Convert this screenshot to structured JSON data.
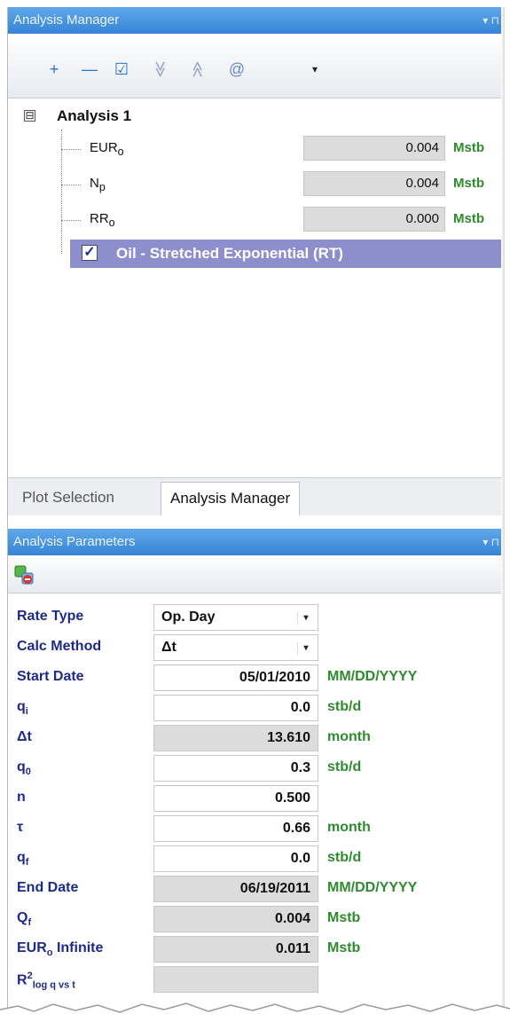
{
  "top_panel": {
    "title": "Analysis Manager",
    "pin_glyphs": "▾ ⊓"
  },
  "toolbar": {
    "add": "+",
    "remove": "—",
    "check": "☑",
    "collapse": "≫",
    "expand": "≪",
    "at": "@",
    "dropdown": "▾"
  },
  "tree": {
    "expander": "⊟",
    "analysis_title": "Analysis 1",
    "items": [
      {
        "label": "EUR",
        "sub": "o",
        "value": "0.004",
        "unit": "Mstb"
      },
      {
        "label": "N",
        "sub": "p",
        "value": "0.004",
        "unit": "Mstb"
      },
      {
        "label": "RR",
        "sub": "o",
        "value": "0.000",
        "unit": "Mstb"
      }
    ],
    "selected_label": "Oil - Stretched Exponential (RT)",
    "selected_check": "✓"
  },
  "tabs": {
    "inactive": "Plot Selection",
    "active": "Analysis Manager"
  },
  "bottom_panel": {
    "title": "Analysis Parameters",
    "pin_glyphs": "▾ ⊓"
  },
  "params": {
    "rate_type": {
      "label": "Rate Type",
      "value": "Op. Day"
    },
    "calc_method": {
      "label": "Calc Method",
      "value": "Δt"
    },
    "start_date": {
      "label": "Start Date",
      "value": "05/01/2010",
      "unit": "MM/DD/YYYY"
    },
    "qi": {
      "label": "q",
      "sub": "i",
      "value": "0.0",
      "unit": "stb/d"
    },
    "dt": {
      "label": "Δt",
      "value": "13.610",
      "unit": "month"
    },
    "q0": {
      "label": "q",
      "sub": "0",
      "value": "0.3",
      "unit": "stb/d"
    },
    "n": {
      "label": "n",
      "value": "0.500"
    },
    "tau": {
      "label": "τ",
      "value": "0.66",
      "unit": "month"
    },
    "qf": {
      "label": "q",
      "sub": "f",
      "value": "0.0",
      "unit": "stb/d"
    },
    "end_date": {
      "label": "End Date",
      "value": "06/19/2011",
      "unit": "MM/DD/YYYY"
    },
    "Qf": {
      "label": "Q",
      "sub": "f",
      "value": "0.004",
      "unit": "Mstb"
    },
    "eur_inf": {
      "label": "EUR",
      "sub": "o",
      "label_tail": " Infinite",
      "value": "0.011",
      "unit": "Mstb"
    },
    "r2": {
      "label": "R",
      "sup": "2",
      "sub": "log q vs t",
      "value": ""
    }
  },
  "select_arrow": "▾"
}
